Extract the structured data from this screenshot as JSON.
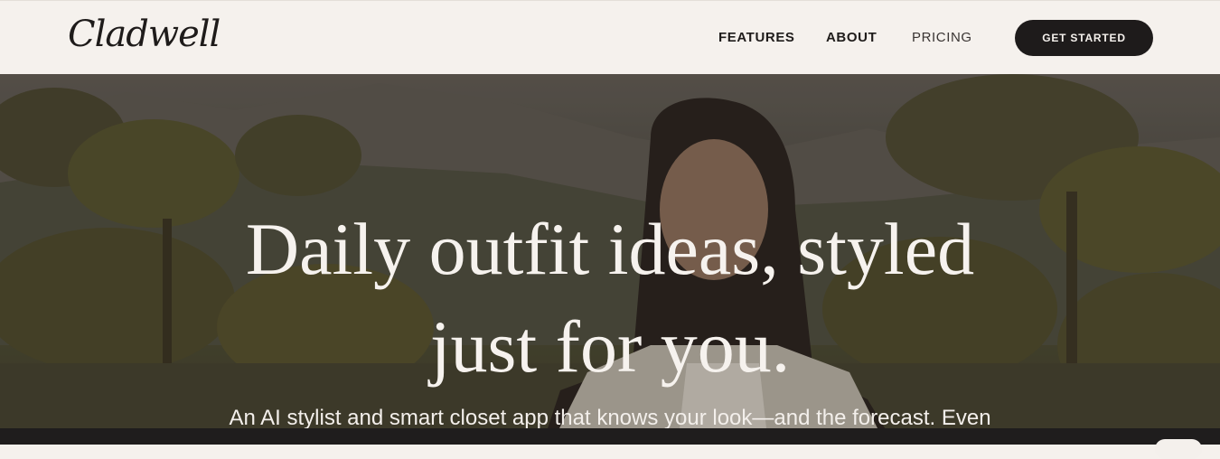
{
  "brand": {
    "logo_text": "Cladwell"
  },
  "nav": {
    "links": [
      {
        "label": "FEATURES"
      },
      {
        "label": "ABOUT"
      },
      {
        "label": "PRICING"
      }
    ],
    "cta_label": "GET STARTED"
  },
  "hero": {
    "headline_line1": "Daily outfit ideas, styled",
    "headline_line2": "just for you.",
    "subheadline": "An AI stylist and smart closet app that knows your look—and the forecast. Even"
  },
  "colors": {
    "background": "#f5f1ed",
    "button": "#1e1b1b",
    "hero_text": "#f6f2ee"
  }
}
